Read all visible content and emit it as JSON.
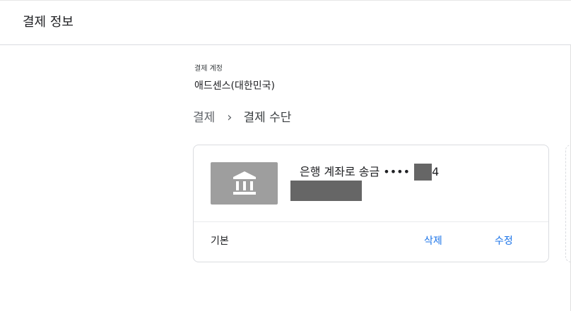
{
  "header": {
    "title": "결제 정보"
  },
  "account": {
    "label": "결제 계정",
    "value": "애드센스(대한민국)"
  },
  "breadcrumb": {
    "root": "결제",
    "separator": "›",
    "current": "결제 수단"
  },
  "payment_method": {
    "icon": "bank-icon",
    "title": "은행 계좌로 송금 ••••",
    "last_digit": "4",
    "status": "기본",
    "delete_label": "삭제",
    "edit_label": "수정"
  },
  "colors": {
    "link": "#1a73e8",
    "tile": "#9e9e9e",
    "redaction": "#666666"
  }
}
